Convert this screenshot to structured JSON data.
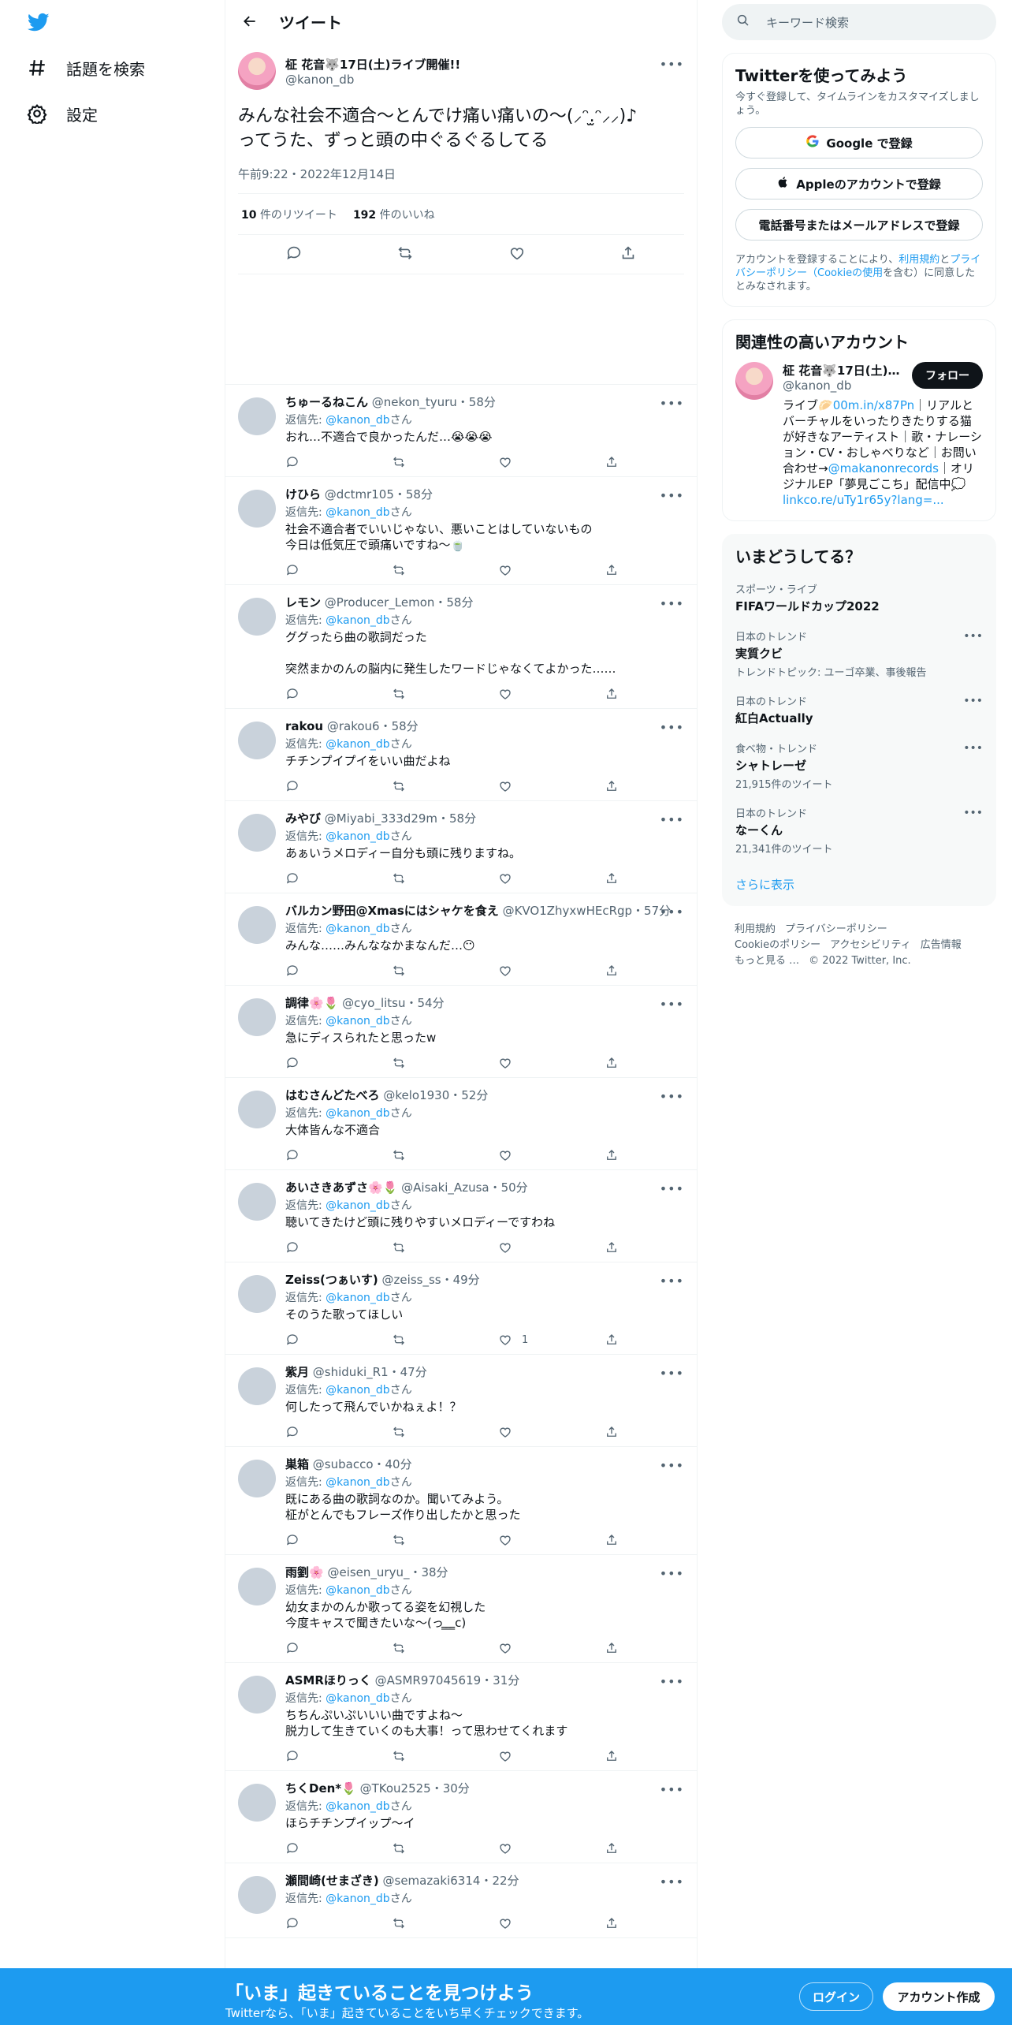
{
  "nav": {
    "explore_label": "話題を検索",
    "settings_label": "設定"
  },
  "header": {
    "title": "ツイート"
  },
  "main_tweet": {
    "name": "柾 花音🐺17日(土)ライブ開催!!",
    "handle": "@kanon_db",
    "text": "みんな社会不適合〜とんでけ痛い痛いの〜(⸝ᵔ.̫ᵔ⸝⸝)♪\nってうた、ずっと頭の中ぐるぐるしてる",
    "time": "午前9:22・2022年12月14日",
    "retweets_count": "10",
    "retweets_label": "件のリツイート",
    "likes_count": "192",
    "likes_label": "件のいいね"
  },
  "replies": [
    {
      "name": "ちゅーるねこん",
      "meta": "@nekon_tyuru・58分",
      "to": "返信先: ",
      "to_handle": "@kanon_db",
      "to_suffix": "さん",
      "text": "おれ…不適合で良かったんだ…😭😭😭",
      "likes": ""
    },
    {
      "name": "けひら",
      "meta": "@dctmr105・58分",
      "to": "返信先: ",
      "to_handle": "@kanon_db",
      "to_suffix": "さん",
      "text": "社会不適合者でいいじゃない、悪いことはしていないもの\n今日は低気圧で頭痛いですね〜🍵",
      "likes": ""
    },
    {
      "name": "レモン",
      "meta": "@Producer_Lemon・58分",
      "to": "返信先: ",
      "to_handle": "@kanon_db",
      "to_suffix": "さん",
      "text": "ググったら曲の歌詞だった\n\n突然まかのんの脳内に発生したワードじゃなくてよかった……",
      "likes": ""
    },
    {
      "name": "rakou",
      "meta": "@rakou6・58分",
      "to": "返信先: ",
      "to_handle": "@kanon_db",
      "to_suffix": "さん",
      "text": "チチンプイプイをいい曲だよね",
      "likes": ""
    },
    {
      "name": "みやび",
      "meta": "@Miyabi_333d29m・58分",
      "to": "返信先: ",
      "to_handle": "@kanon_db",
      "to_suffix": "さん",
      "text": "あぁいうメロディー自分も頭に残りますね。",
      "likes": ""
    },
    {
      "name": "バルカン野田@Xmasにはシャケを食え",
      "meta": "@KVO1ZhyxwHEcRgp・57分",
      "to": "返信先: ",
      "to_handle": "@kanon_db",
      "to_suffix": "さん",
      "text": "みんな……みんななかまなんだ…😶",
      "likes": ""
    },
    {
      "name": "調律🌸🌷",
      "meta": "@cyo_litsu・54分",
      "to": "返信先: ",
      "to_handle": "@kanon_db",
      "to_suffix": "さん",
      "text": "急にディスられたと思ったw",
      "likes": ""
    },
    {
      "name": "はむさんどたべろ",
      "meta": "@kelo1930・52分",
      "to": "返信先: ",
      "to_handle": "@kanon_db",
      "to_suffix": "さん",
      "text": "大体皆んな不適合",
      "likes": ""
    },
    {
      "name": "あいさきあずさ🌸🌷",
      "meta": "@Aisaki_Azusa・50分",
      "to": "返信先: ",
      "to_handle": "@kanon_db",
      "to_suffix": "さん",
      "text": "聴いてきたけど頭に残りやすいメロディーですわね",
      "likes": ""
    },
    {
      "name": "Zeiss(つぁいす)",
      "meta": "@zeiss_ss・49分",
      "to": "返信先: ",
      "to_handle": "@kanon_db",
      "to_suffix": "さん",
      "text": "そのうた歌ってほしい",
      "likes": "1"
    },
    {
      "name": "紫月",
      "meta": "@shiduki_R1・47分",
      "to": "返信先: ",
      "to_handle": "@kanon_db",
      "to_suffix": "さん",
      "text": "何したって飛んでいかねぇよ！？",
      "likes": ""
    },
    {
      "name": "巣箱",
      "meta": "@subacco・40分",
      "to": "返信先: ",
      "to_handle": "@kanon_db",
      "to_suffix": "さん",
      "text": "既にある曲の歌詞なのか。聞いてみよう。\n柾がとんでもフレーズ作り出したかと思った",
      "likes": ""
    },
    {
      "name": "雨劉🌸",
      "meta": "@eisen_uryu_・38分",
      "to": "返信先: ",
      "to_handle": "@kanon_db",
      "to_suffix": "さん",
      "text": "幼女まかのんか歌ってる姿を幻視した\n今度キャスで聞きたいな〜(っ ̳ ̳ ̳c)",
      "likes": ""
    },
    {
      "name": "ASMRほりっく",
      "meta": "@ASMR97045619・31分",
      "to": "返信先: ",
      "to_handle": "@kanon_db",
      "to_suffix": "さん",
      "text": "ちちんぷいぷいいい曲ですよね～\n脱力して生きていくのも大事！って思わせてくれます",
      "likes": ""
    },
    {
      "name": "ちくDen*🌷",
      "meta": "@TKou2525・30分",
      "to": "返信先: ",
      "to_handle": "@kanon_db",
      "to_suffix": "さん",
      "text": "ほらチチンプイップ～イ",
      "likes": ""
    },
    {
      "name": "瀬間崎(せまざき)",
      "meta": "@semazaki6314・22分",
      "to": "返信先: ",
      "to_handle": "@kanon_db",
      "to_suffix": "さん",
      "text": "",
      "likes": ""
    }
  ],
  "search": {
    "placeholder": "キーワード検索"
  },
  "signup_card": {
    "title": "Twitterを使ってみよう",
    "sub": "今すぐ登録して、タイムラインをカスタマイズしましょう。",
    "google": "Google で登録",
    "apple": "Appleのアカウントで登録",
    "phone": "電話番号またはメールアドレスで登録",
    "terms_pre": "アカウントを登録することにより、",
    "terms_link1": "利用規約",
    "terms_mid": "と",
    "terms_link2": "プライバシーポリシー（Cookieの使用",
    "terms_post": "を含む）に同意したとみなされます。"
  },
  "related_card": {
    "title": "関連性の高いアカウント",
    "name": "柾 花音🐺17日(土)ラ...",
    "handle": "@kanon_db",
    "follow": "フォロー",
    "bio_1": "ライブ🥟",
    "bio_link1": "00m.in/x87Pn",
    "bio_2": "｜リアルとバーチャルをいったりきたりする猫が好きなアーティスト｜歌・ナレーション・CV・おしゃべりなど｜お問い合わせ→",
    "bio_link2": "@makanonrecords",
    "bio_3": "｜オリジナルEP「夢見ごこち」配信中💭",
    "bio_link3": "linkco.re/uTy1r65y?lang=..."
  },
  "trends_card": {
    "title": "いまどうしてる？",
    "items": [
      {
        "cat": "スポーツ・ライブ",
        "name": "FIFAワールドカップ2022",
        "extra": "",
        "dots": ""
      },
      {
        "cat": "日本のトレンド",
        "name": "実質クビ",
        "extra": "トレンドトピック: ユーゴ卒業、事後報告",
        "dots": "•••"
      },
      {
        "cat": "日本のトレンド",
        "name": "紅白Actually",
        "extra": "",
        "dots": "•••"
      },
      {
        "cat": "食べ物・トレンド",
        "name": "シャトレーゼ",
        "extra": "21,915件のツイート",
        "dots": "•••"
      },
      {
        "cat": "日本のトレンド",
        "name": "なーくん",
        "extra": "21,341件のツイート",
        "dots": "•••"
      }
    ],
    "show_more": "さらに表示"
  },
  "footer": {
    "terms": "利用規約",
    "privacy": "プライバシーポリシー",
    "cookie": "Cookieのポリシー",
    "accessibility": "アクセシビリティ",
    "ads": "広告情報",
    "more": "もっと見る …",
    "copyright": "© 2022 Twitter, Inc."
  },
  "bottombar": {
    "title": "「いま」起きていることを見つけよう",
    "sub": "Twitterなら、「いま」起きていることをいち早くチェックできます。",
    "login": "ログイン",
    "signup": "アカウント作成"
  },
  "colors": {
    "accent": "#1d9bf0",
    "text": "#0f1419",
    "muted": "#536471"
  }
}
